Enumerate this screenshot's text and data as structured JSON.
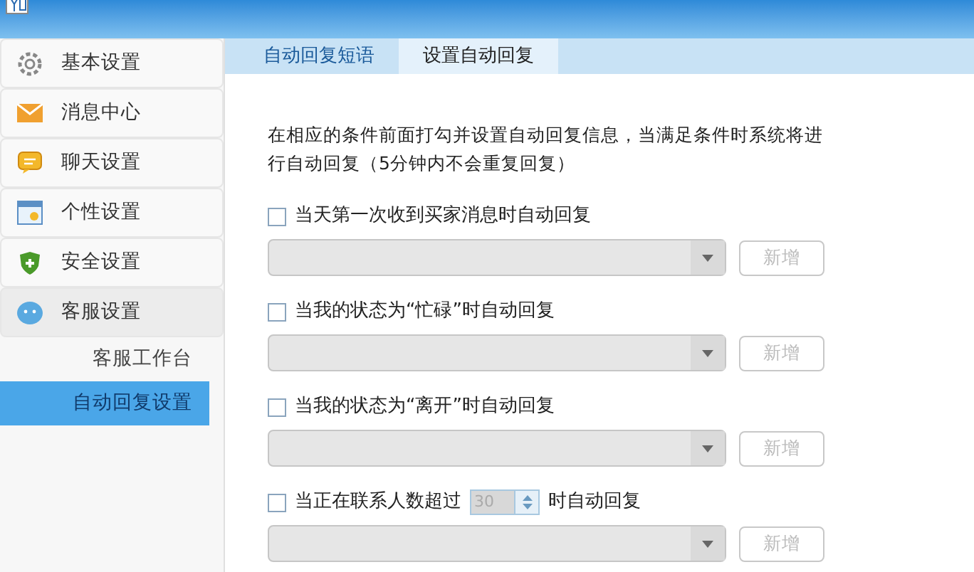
{
  "sidebar": {
    "items": [
      {
        "label": "基本设置",
        "expanded": false
      },
      {
        "label": "消息中心",
        "expanded": false
      },
      {
        "label": "聊天设置",
        "expanded": false
      },
      {
        "label": "个性设置",
        "expanded": false
      },
      {
        "label": "安全设置",
        "expanded": false
      },
      {
        "label": "客服设置",
        "expanded": true,
        "children": [
          {
            "label": "客服工作台",
            "selected": false
          },
          {
            "label": "自动回复设置",
            "selected": true
          }
        ]
      }
    ]
  },
  "tabs": [
    {
      "label": "自动回复短语",
      "selected": false
    },
    {
      "label": "设置自动回复",
      "selected": true
    }
  ],
  "intro": "在相应的条件前面打勾并设置自动回复信息，当满足条件时系统将进行自动回复（5分钟内不会重复回复）",
  "conditions": [
    {
      "kind": "plain",
      "label": "当天第一次收到买家消息时自动回复",
      "checked": false,
      "button": "新增"
    },
    {
      "kind": "plain",
      "label": "当我的状态为“忙碌”时自动回复",
      "checked": false,
      "button": "新增"
    },
    {
      "kind": "plain",
      "label": "当我的状态为“离开”时自动回复",
      "checked": false,
      "button": "新增"
    },
    {
      "kind": "count",
      "label": "当正在联系人数超过",
      "count": "30",
      "label_after": "时自动回复",
      "checked": false,
      "button": "新增"
    }
  ]
}
